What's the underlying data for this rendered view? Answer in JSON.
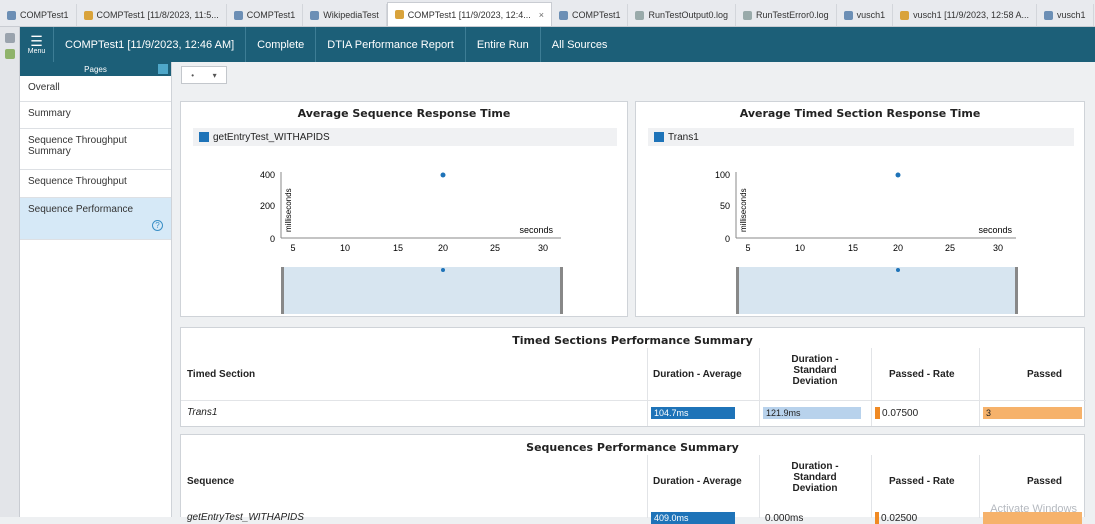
{
  "tabs": [
    {
      "label": "COMPTest1",
      "icon": "circle-gear-icon"
    },
    {
      "label": "COMPTest1 [11/8/2023, 11:5...",
      "icon": "clipboard-icon"
    },
    {
      "label": "COMPTest1",
      "icon": "file-icon"
    },
    {
      "label": "WikipediaTest",
      "icon": "flask-icon"
    },
    {
      "label": "COMPTest1 [11/9/2023, 12:4...",
      "icon": "clipboard-icon",
      "active": true
    },
    {
      "label": "COMPTest1",
      "icon": "file-icon"
    },
    {
      "label": "RunTestOutput0.log",
      "icon": "log-icon"
    },
    {
      "label": "RunTestError0.log",
      "icon": "log-icon"
    },
    {
      "label": "vusch1",
      "icon": "flask-icon"
    },
    {
      "label": "vusch1 [11/9/2023, 12:58 A...",
      "icon": "clipboard-icon"
    },
    {
      "label": "vusch1",
      "icon": "file-icon"
    }
  ],
  "header": {
    "menu_label": "Menu",
    "title": "COMPTest1 [11/9/2023, 12:46 AM]",
    "status": "Complete",
    "report": "DTIA Performance Report",
    "scope": "Entire Run",
    "sources": "All Sources"
  },
  "sidebar": {
    "heading": "Pages",
    "items": [
      {
        "label": "Overall"
      },
      {
        "label": "Summary"
      },
      {
        "label": "Sequence Throughput Summary"
      },
      {
        "label": "Sequence Throughput"
      },
      {
        "label": "Sequence Performance",
        "selected": true
      }
    ]
  },
  "pager": {
    "symbol": "▾"
  },
  "charts": [
    {
      "title": "Average Sequence Response Time",
      "legend": "getEntryTest_WITHAPIDS",
      "ylabel": "milliseconds",
      "xlabel": "seconds",
      "yticks": [
        "400",
        "200",
        "0"
      ],
      "xticks": [
        "5",
        "10",
        "15",
        "20",
        "25",
        "30"
      ]
    },
    {
      "title": "Average Timed Section Response Time",
      "legend": "Trans1",
      "ylabel": "milliseconds",
      "xlabel": "seconds",
      "yticks": [
        "100",
        "50",
        "0"
      ],
      "xticks": [
        "5",
        "10",
        "15",
        "20",
        "25",
        "30"
      ]
    }
  ],
  "timed_summary": {
    "title": "Timed Sections Performance Summary",
    "headers": [
      "Timed Section",
      "Duration - Average",
      "Duration - Standard Deviation",
      "Passed - Rate",
      "Passed"
    ],
    "row": {
      "name": "Trans1",
      "avg": "104.7ms",
      "std": "121.9ms",
      "rate": "0.07500",
      "passed": "3"
    }
  },
  "seq_summary": {
    "title": "Sequences Performance Summary",
    "headers": [
      "Sequence",
      "Duration - Average",
      "Duration - Standard Deviation",
      "Passed - Rate",
      "Passed"
    ],
    "row": {
      "name": "getEntryTest_WITHAPIDS",
      "avg": "409.0ms",
      "std": "0.000ms",
      "rate": "0.02500",
      "passed": ""
    }
  },
  "watermark": "Activate Windows",
  "colors": {
    "header": "#1c5f78",
    "series": "#1e73b8",
    "std_bar": "#b8d2ec",
    "rate_bar": "#f08a24",
    "passed_bar": "#f6b26b"
  }
}
